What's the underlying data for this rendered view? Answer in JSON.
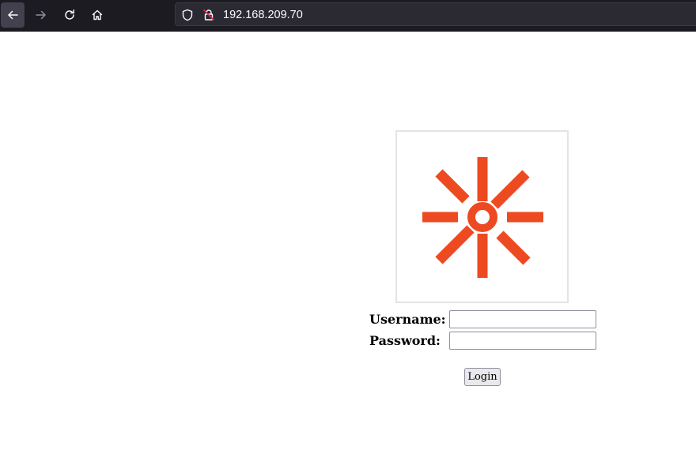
{
  "browser": {
    "url": "192.168.209.70",
    "icons": {
      "back": "arrow-left-icon",
      "forward": "arrow-right-icon",
      "reload": "reload-icon",
      "home": "home-icon",
      "tracking": "shield-icon",
      "connection": "insecure-lock-icon"
    }
  },
  "page": {
    "logo": {
      "icon": "starburst-logo",
      "color": "#ee4a22"
    },
    "form": {
      "username_label": "Username:",
      "username_value": "",
      "password_label": "Password:",
      "password_value": "",
      "login_label": "Login"
    }
  }
}
